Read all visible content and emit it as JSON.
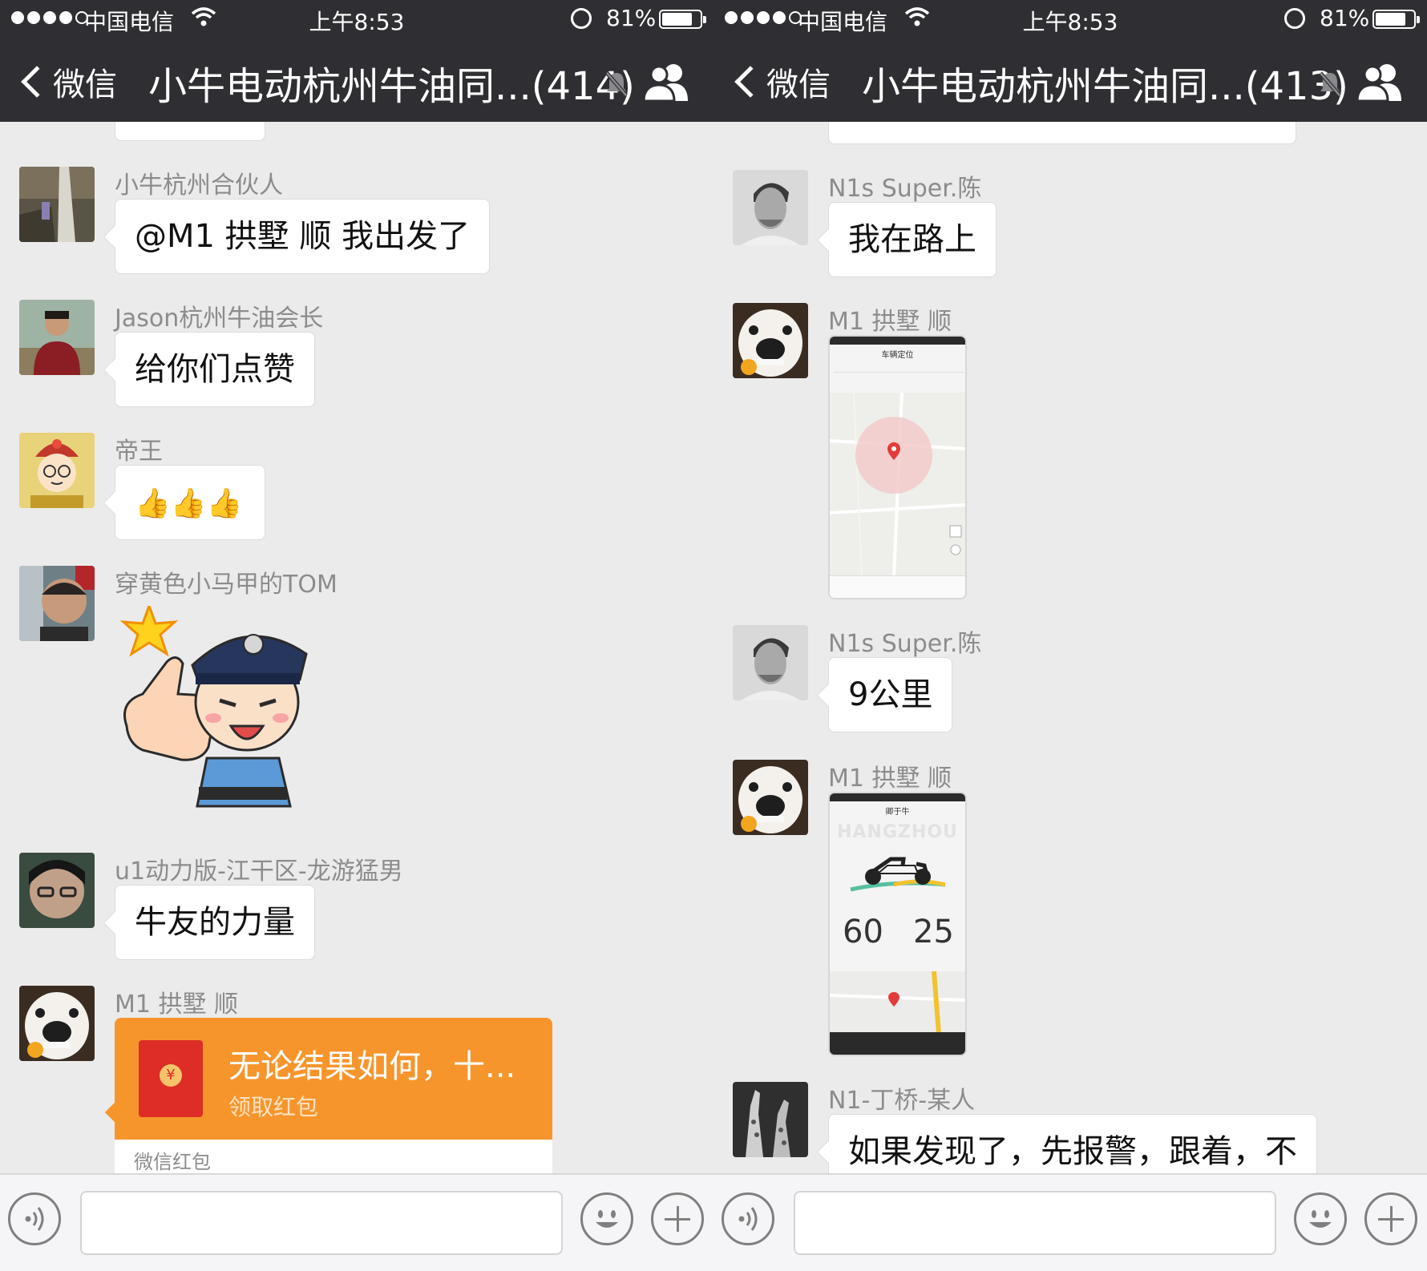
{
  "status_bar": {
    "carrier": "中国电信",
    "time": "上午8:53",
    "battery": "81%"
  },
  "left": {
    "nav": {
      "back_label": "微信",
      "title": "小牛电动杭州牛油同...(414)"
    },
    "messages": [
      {
        "sender": "小牛杭州合伙人",
        "text": "@M1 拱墅 顺 我出发了"
      },
      {
        "sender": "Jason杭州牛油会长",
        "text": "给你们点赞"
      },
      {
        "sender": "帝王",
        "text": "👍👍👍"
      },
      {
        "sender": "穿黄色小马甲的TOM"
      },
      {
        "sender": "u1动力版-江干区-龙游猛男",
        "text": "牛友的力量"
      },
      {
        "sender": "M1 拱墅 顺",
        "red_packet": {
          "title": "无论结果如何，十...",
          "subtitle": "领取红包",
          "footer": "微信红包"
        }
      }
    ]
  },
  "right": {
    "nav": {
      "back_label": "微信",
      "title": "小牛电动杭州牛油同...(413)"
    },
    "messages": [
      {
        "sender": "N1s Super.陈",
        "text": "我在路上"
      },
      {
        "sender": "M1 拱墅 顺"
      },
      {
        "sender": "N1s Super.陈",
        "text": "9公里"
      },
      {
        "sender": "M1 拱墅 顺"
      },
      {
        "sender": "N1-丁桥-某人",
        "text": "如果发现了，先报警，跟着，不"
      }
    ],
    "screenshot_1": {
      "header": "车辆定位"
    },
    "screenshot_2": {
      "header": "卿于牛",
      "city": "HANGZHOU",
      "battery_value": "60",
      "range_value": "25"
    }
  },
  "colors": {
    "nav_bg": "#2f2f33",
    "chat_bg": "#ebebeb",
    "bubble_bg": "#ffffff",
    "red_packet": "#f7952d",
    "sender_text": "#8c8c8c"
  },
  "icons": [
    "back-chevron-icon",
    "mute-bell-icon",
    "group-members-icon",
    "voice-icon",
    "emoji-icon",
    "plus-icon"
  ]
}
